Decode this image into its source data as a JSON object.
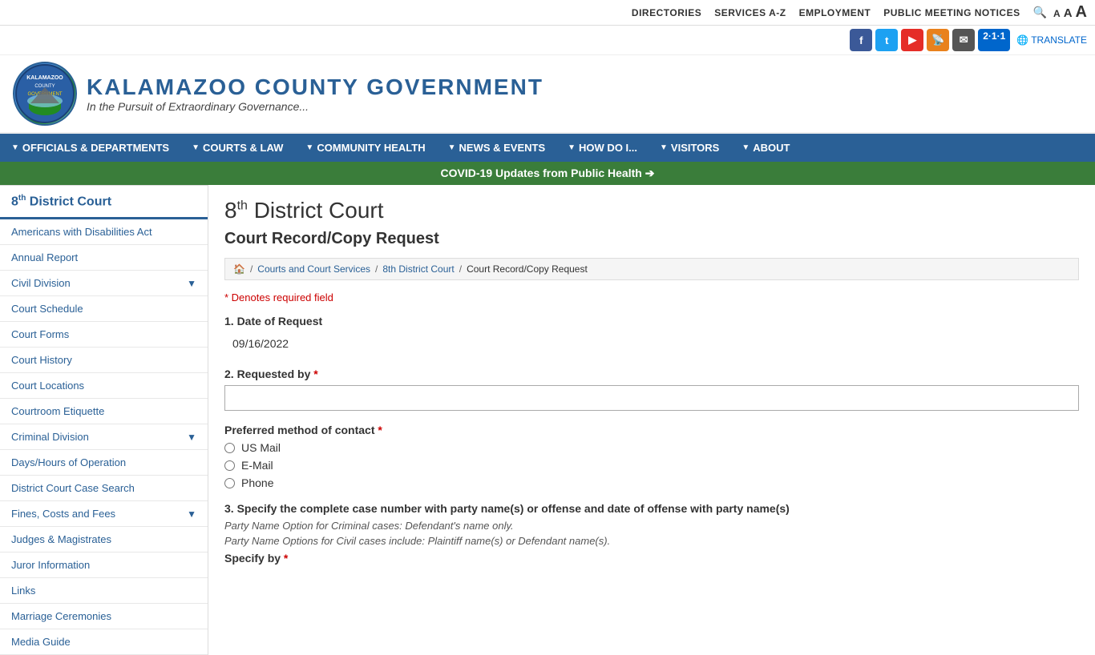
{
  "topbar": {
    "links": [
      "DIRECTORIES",
      "SERVICES A-Z",
      "EMPLOYMENT",
      "PUBLIC MEETING NOTICES"
    ],
    "font_sizes": [
      "A",
      "A",
      "A"
    ],
    "translate": "TRANSLATE"
  },
  "header": {
    "county": "KALAMAZOO COUNTY GOVERNMENT",
    "tagline": "In the Pursuit of Extraordinary Governance..."
  },
  "nav": {
    "items": [
      "OFFICIALS & DEPARTMENTS",
      "COURTS & LAW",
      "COMMUNITY HEALTH",
      "NEWS & EVENTS",
      "HOW DO I...",
      "VISITORS",
      "ABOUT"
    ]
  },
  "covid_bar": "COVID-19 Updates from Public Health ➔",
  "sidebar": {
    "title_pre": "8",
    "title_sup": "th",
    "title_post": " District Court",
    "items": [
      {
        "label": "Americans with Disabilities Act",
        "has_arrow": false
      },
      {
        "label": "Annual Report",
        "has_arrow": false
      },
      {
        "label": "Civil Division",
        "has_arrow": true
      },
      {
        "label": "Court Schedule",
        "has_arrow": false
      },
      {
        "label": "Court Forms",
        "has_arrow": false
      },
      {
        "label": "Court History",
        "has_arrow": false
      },
      {
        "label": "Court Locations",
        "has_arrow": false
      },
      {
        "label": "Courtroom Etiquette",
        "has_arrow": false
      },
      {
        "label": "Criminal Division",
        "has_arrow": true
      },
      {
        "label": "Days/Hours of Operation",
        "has_arrow": false
      },
      {
        "label": "District Court Case Search",
        "has_arrow": false
      },
      {
        "label": "Fines, Costs and Fees",
        "has_arrow": true
      },
      {
        "label": "Judges & Magistrates",
        "has_arrow": false
      },
      {
        "label": "Juror Information",
        "has_arrow": false
      },
      {
        "label": "Links",
        "has_arrow": false
      },
      {
        "label": "Marriage Ceremonies",
        "has_arrow": false
      },
      {
        "label": "Media Guide",
        "has_arrow": false
      }
    ]
  },
  "page": {
    "title_pre": "8",
    "title_sup": "th",
    "title_post": " District Court",
    "subtitle": "Court Record/Copy Request",
    "breadcrumb": {
      "home": "🏠",
      "courts": "Courts and Court Services",
      "district": "8th District Court",
      "current": "Court Record/Copy Request"
    },
    "required_note": "* Denotes required field",
    "form": {
      "q1_label": "1. Date of Request",
      "q1_value": "09/16/2022",
      "q2_label": "2. Requested by",
      "q2_required": "*",
      "contact_label": "Preferred method of contact",
      "contact_required": "*",
      "contact_options": [
        "US Mail",
        "E-Mail",
        "Phone"
      ],
      "q3_label": "3. Specify the complete case number with party name(s) or offense and date of offense with party name(s)",
      "q3_hint1": "Party Name Option for Criminal cases: Defendant's name only.",
      "q3_hint2": "Party Name Options for Civil cases include: Plaintiff name(s) or Defendant name(s).",
      "q3_specify": "Specify by",
      "q3_specify_req": "*"
    }
  }
}
